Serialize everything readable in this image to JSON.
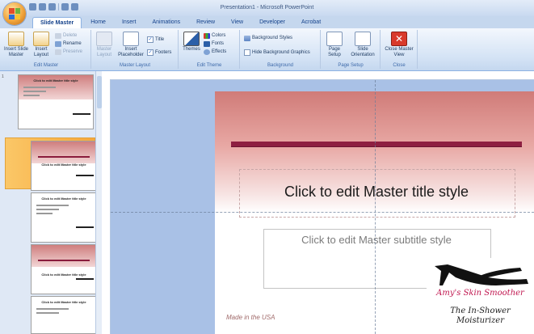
{
  "window": {
    "title": "Presentation1 - Microsoft PowerPoint"
  },
  "tabs": [
    "Slide Master",
    "Home",
    "Insert",
    "Animations",
    "Review",
    "View",
    "Developer",
    "Acrobat"
  ],
  "ribbon": {
    "edit_master": {
      "label": "Edit Master",
      "insert_slide_master": "Insert Slide Master",
      "insert_layout": "Insert Layout",
      "delete": "Delete",
      "rename": "Rename",
      "preserve": "Preserve"
    },
    "master_layout": {
      "label": "Master Layout",
      "master_layout_btn": "Master Layout",
      "insert_placeholder": "Insert Placeholder",
      "title": "Title",
      "footers": "Footers"
    },
    "edit_theme": {
      "label": "Edit Theme",
      "themes": "Themes",
      "colors": "Colors",
      "fonts": "Fonts",
      "effects": "Effects"
    },
    "background": {
      "label": "Background",
      "background_styles": "Background Styles",
      "hide_background_graphics": "Hide Background Graphics"
    },
    "page_setup": {
      "label": "Page Setup",
      "page_setup_btn": "Page Setup",
      "slide_orientation": "Slide Orientation"
    },
    "close": {
      "label": "Close",
      "close_master_view": "Close Master View"
    }
  },
  "thumbnails": [
    {
      "number": "1",
      "title": "Click to edit Master title style"
    },
    {
      "number": "",
      "title": "Click to edit Master title style"
    },
    {
      "number": "",
      "title": "Click to edit Master title style"
    },
    {
      "number": "",
      "title": "Click to edit Master title style"
    },
    {
      "number": "",
      "title": "Click to edit Master title style"
    }
  ],
  "slide": {
    "title": "Click to edit Master title style",
    "subtitle": "Click to edit Master subtitle style",
    "footer": "Made in the USA",
    "logo_brand": "Amy's Skin Smoother",
    "logo_tagline_1": "The In-Shower",
    "logo_tagline_2": "Moisturizer"
  },
  "colors": {
    "accent_bar": "#8e1f41",
    "pink_gradient": "#d07b78",
    "selection": "#f6a73b"
  }
}
